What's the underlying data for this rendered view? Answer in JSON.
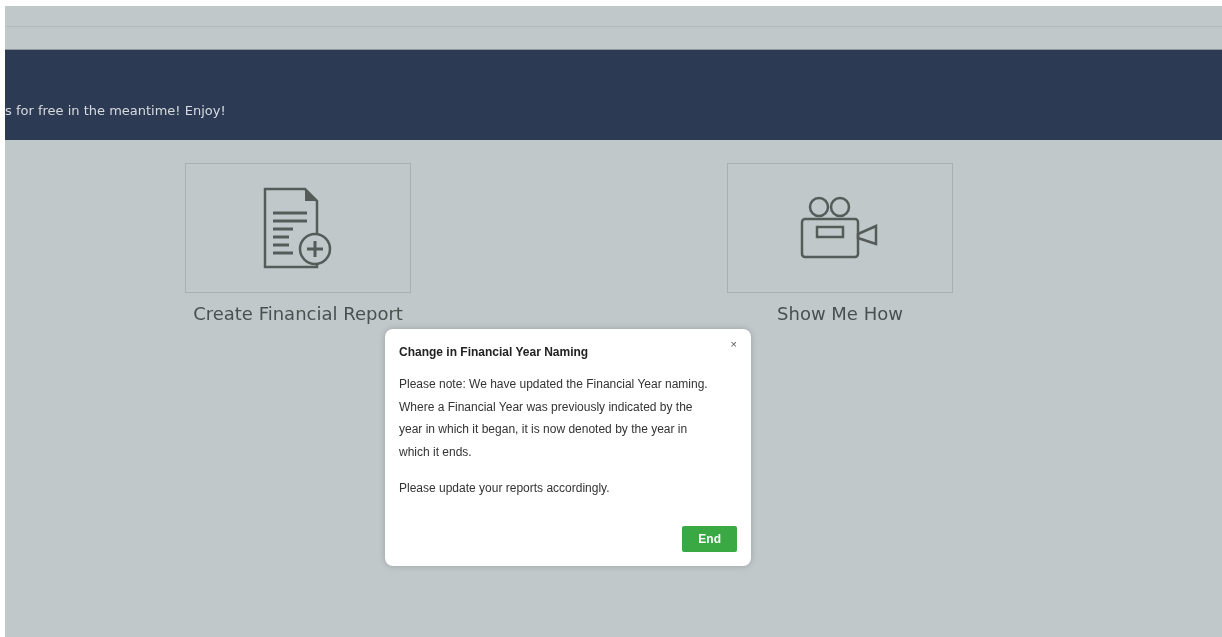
{
  "banner": {
    "message": "s for free in the meantime! Enjoy!"
  },
  "actions": [
    {
      "kind": "report",
      "label": "Create Financial Report"
    },
    {
      "kind": "video",
      "label": "Show Me How"
    }
  ],
  "dialog": {
    "title": "Change in Financial Year Naming",
    "close": "×",
    "paragraphs": [
      "Please note: We have updated the Financial Year naming. Where a Financial Year was previously indicated by the year in which it began, it is now denoted by the year in which it ends.",
      "Please update your reports accordingly."
    ],
    "button": "End"
  }
}
